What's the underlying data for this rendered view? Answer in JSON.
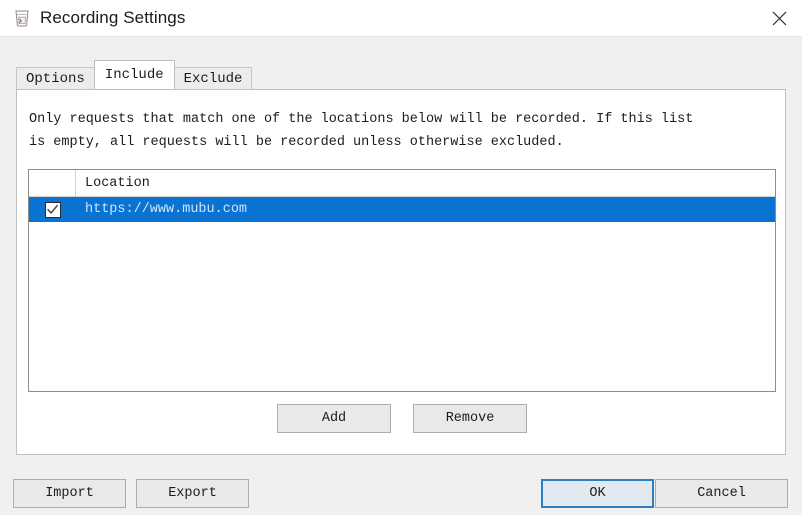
{
  "window": {
    "title": "Recording Settings",
    "icon": "app-glass-icon",
    "close_label": "✕"
  },
  "tabs": [
    {
      "id": "options",
      "label": "Options",
      "active": false
    },
    {
      "id": "include",
      "label": "Include",
      "active": true
    },
    {
      "id": "exclude",
      "label": "Exclude",
      "active": false
    }
  ],
  "panel": {
    "description": "Only requests that match one of the locations below will be recorded. If this list\nis empty, all requests will be recorded unless otherwise excluded."
  },
  "table": {
    "columns": [
      "",
      "Location"
    ],
    "header_location": "Location",
    "rows": [
      {
        "checked": true,
        "location": "https://www.mubu.com",
        "selected": true
      }
    ]
  },
  "list_buttons": {
    "add": "Add",
    "remove": "Remove"
  },
  "footer": {
    "import": "Import",
    "export": "Export",
    "ok": "OK",
    "cancel": "Cancel"
  },
  "colors": {
    "selection_blue": "#0a72d0",
    "focus_border": "#2a7fc4",
    "window_bg": "#f0f0f0",
    "panel_bg": "#ffffff",
    "row_text": "#cfe6fa"
  }
}
